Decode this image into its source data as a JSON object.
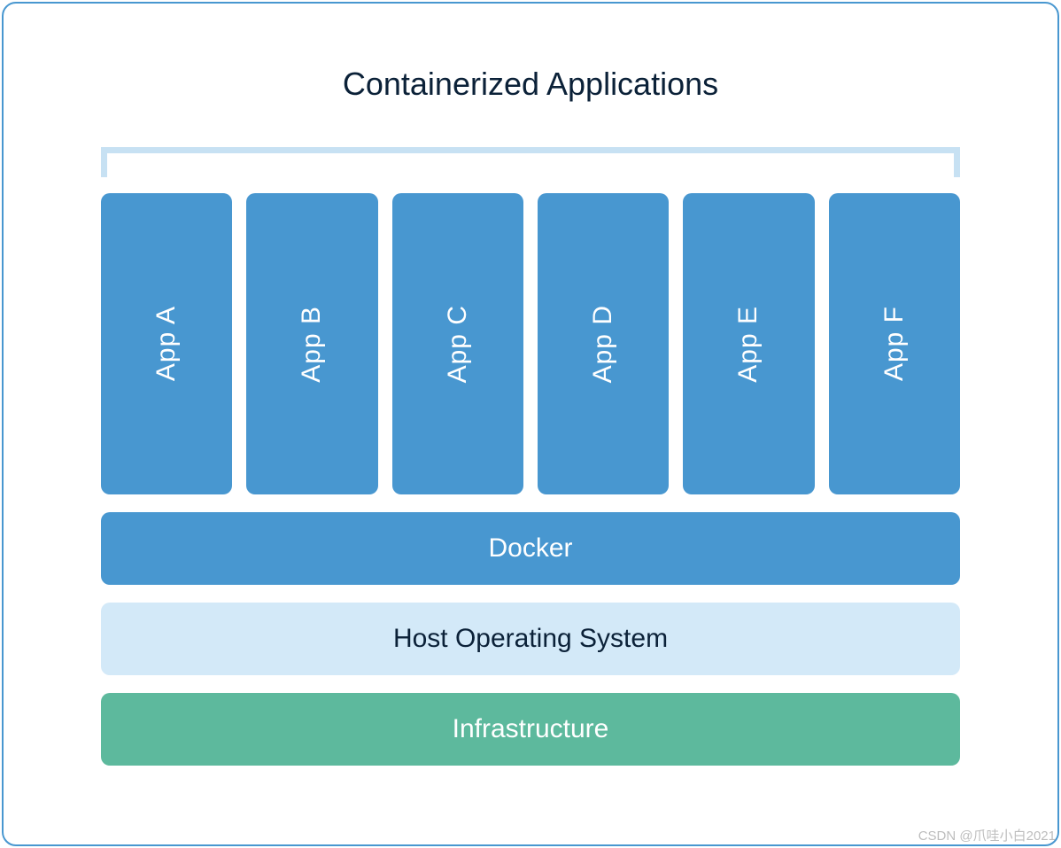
{
  "title": "Containerized Applications",
  "apps": {
    "0": "App A",
    "1": "App B",
    "2": "App C",
    "3": "App D",
    "4": "App E",
    "5": "App F"
  },
  "layers": {
    "docker": "Docker",
    "host": "Host Operating System",
    "infra": "Infrastructure"
  },
  "watermark": "CSDN @爪哇小白2021",
  "colors": {
    "frame_border": "#4897d0",
    "app_bg": "#4897d0",
    "docker_bg": "#4897d0",
    "host_bg": "#d3e9f8",
    "infra_bg": "#5db99d",
    "bracket": "#c7e1f3",
    "title_text": "#0b2138"
  }
}
